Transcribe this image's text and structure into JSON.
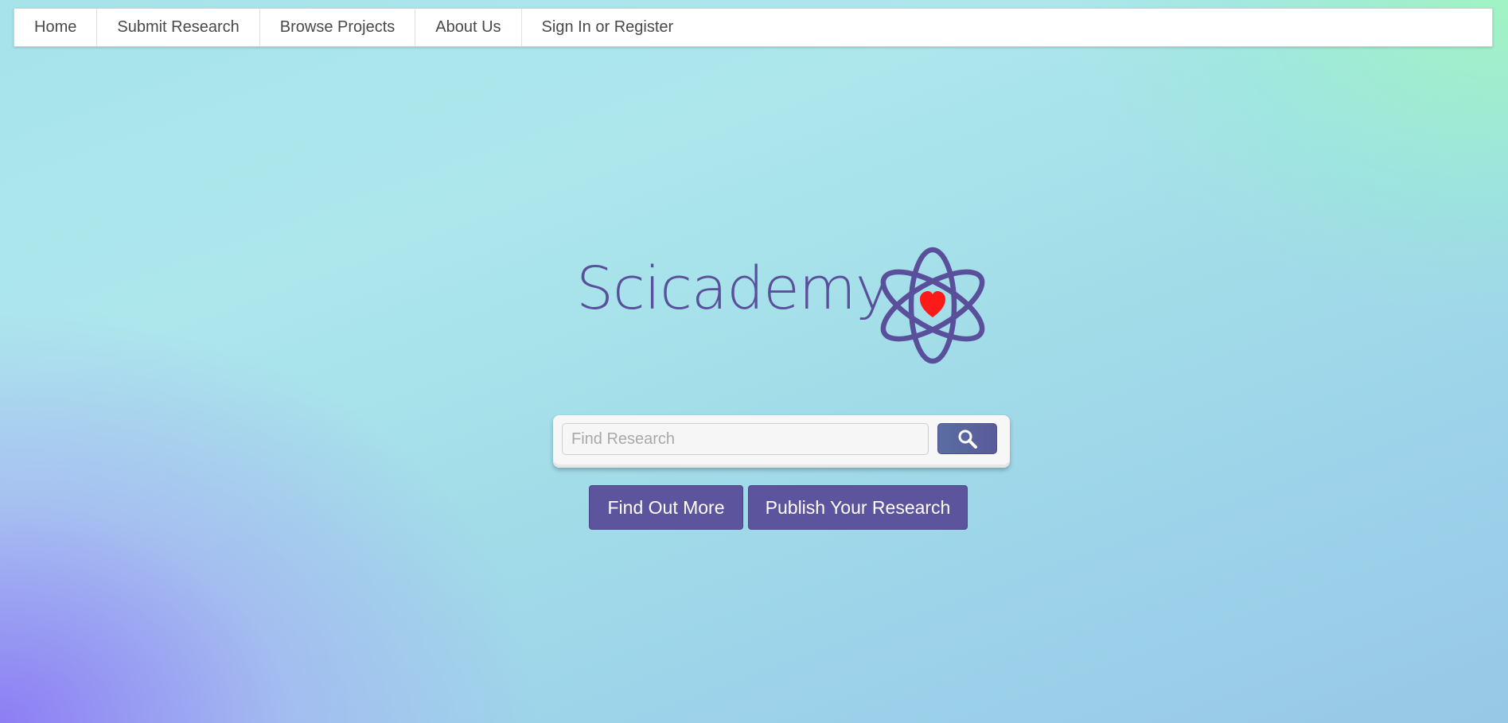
{
  "nav": {
    "items": [
      {
        "label": "Home"
      },
      {
        "label": "Submit Research"
      },
      {
        "label": "Browse Projects"
      },
      {
        "label": "About Us"
      },
      {
        "label": "Sign In or Register"
      }
    ]
  },
  "brand": {
    "name": "Scicademy",
    "icon": "atom-heart-icon"
  },
  "search": {
    "placeholder": "Find Research",
    "value": "",
    "button_icon": "search-icon"
  },
  "actions": {
    "find_out_more": "Find Out More",
    "publish": "Publish Your Research"
  },
  "colors": {
    "brand_purple": "#5a4f9a",
    "button_purple": "#5c559d",
    "heart_red": "#ff1a1a"
  }
}
